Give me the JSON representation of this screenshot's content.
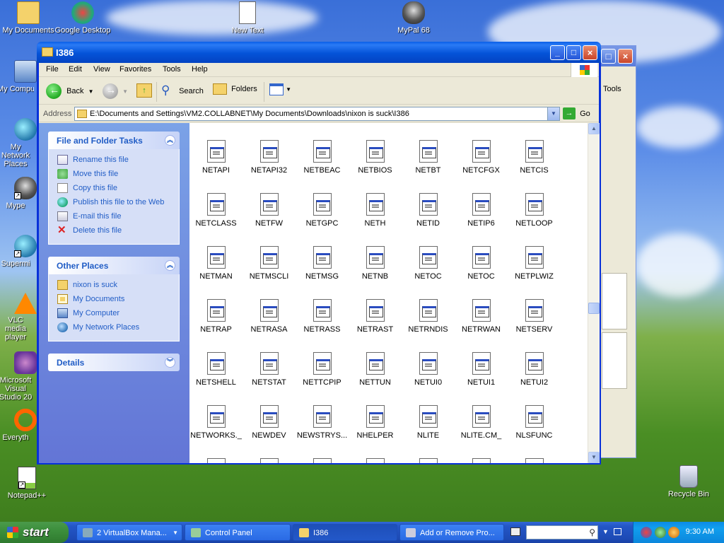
{
  "desktop": {
    "icons": [
      {
        "label": "My Documents"
      },
      {
        "label": "Google Desktop"
      },
      {
        "label": "New Text Document"
      },
      {
        "label": "MyPal 68"
      },
      {
        "label": "My Computer"
      },
      {
        "label": "My Network Places"
      },
      {
        "label": "Mype"
      },
      {
        "label": "Supermi"
      },
      {
        "label": "VLC media player"
      },
      {
        "label": "Microsoft Visual Studio 20"
      },
      {
        "label": "Everyth"
      },
      {
        "label": "Notepad++"
      },
      {
        "label": "Recycle Bin"
      }
    ]
  },
  "background_window": {
    "tools_label": "Tools"
  },
  "window": {
    "title": "I386",
    "menu": [
      "File",
      "Edit",
      "View",
      "Favorites",
      "Tools",
      "Help"
    ],
    "toolbar": {
      "back": "Back",
      "search": "Search",
      "folders": "Folders"
    },
    "address": {
      "label": "Address",
      "value": "E:\\Documents and Settings\\VM2.COLLABNET\\My Documents\\Downloads\\nixon is suck\\I386",
      "go": "Go"
    }
  },
  "taskpane": {
    "file_tasks": {
      "title": "File and Folder Tasks",
      "items": [
        "Rename this file",
        "Move this file",
        "Copy this file",
        "Publish this file to the Web",
        "E-mail this file",
        "Delete this file"
      ]
    },
    "other_places": {
      "title": "Other Places",
      "items": [
        "nixon is suck",
        "My Documents",
        "My Computer",
        "My Network Places"
      ]
    },
    "details": {
      "title": "Details"
    }
  },
  "files": [
    [
      "NETAPI",
      "NETAPI32",
      "NETBEAC",
      "NETBIOS",
      "NETBT",
      "NETCFGX",
      "NETCIS"
    ],
    [
      "NETCLASS",
      "NETFW",
      "NETGPC",
      "NETH",
      "NETID",
      "NETIP6",
      "NETLOOP"
    ],
    [
      "NETMAN",
      "NETMSCLI",
      "NETMSG",
      "NETNB",
      "NETOC",
      "NETOC",
      "NETPLWIZ"
    ],
    [
      "NETRAP",
      "NETRASA",
      "NETRASS",
      "NETRAST",
      "NETRNDIS",
      "NETRWAN",
      "NETSERV"
    ],
    [
      "NETSHELL",
      "NETSTAT",
      "NETTCPIP",
      "NETTUN",
      "NETUI0",
      "NETUI1",
      "NETUI2"
    ],
    [
      "NETWORKS._",
      "NEWDEV",
      "NEWSTRYS...",
      "NHELPER",
      "NLITE",
      "NLITE.CM_",
      "NLSFUNC"
    ]
  ],
  "taskbar": {
    "start": "start",
    "tasks": [
      {
        "label": "2 VirtualBox Mana..."
      },
      {
        "label": "Control Panel"
      },
      {
        "label": "I386"
      },
      {
        "label": "Add or Remove Pro..."
      }
    ],
    "clock": "9:30 AM"
  }
}
